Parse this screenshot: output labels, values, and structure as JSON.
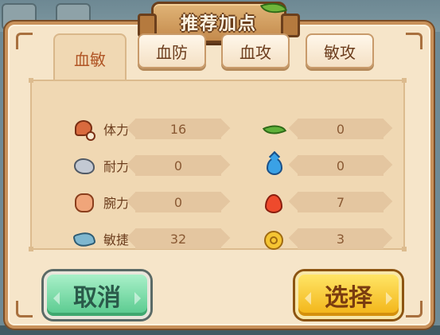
{
  "title": "推荐加点",
  "tabs": [
    {
      "label": "血敏",
      "active": true
    },
    {
      "label": "血防",
      "active": false
    },
    {
      "label": "血攻",
      "active": false
    },
    {
      "label": "敏攻",
      "active": false
    }
  ],
  "stats_left": [
    {
      "icon": "meat-icon",
      "label": "体力",
      "value": "16"
    },
    {
      "icon": "stone-icon",
      "label": "耐力",
      "value": "0"
    },
    {
      "icon": "fist-icon",
      "label": "腕力",
      "value": "0"
    },
    {
      "icon": "wing-icon",
      "label": "敏捷",
      "value": "32"
    }
  ],
  "stats_right": [
    {
      "icon": "leaf-icon",
      "value": "0"
    },
    {
      "icon": "water-drop-icon",
      "value": "0"
    },
    {
      "icon": "fire-icon",
      "value": "7"
    },
    {
      "icon": "wind-swirl-icon",
      "value": "3"
    }
  ],
  "buttons": {
    "cancel": "取消",
    "confirm": "选择"
  },
  "colors": {
    "parchment": "#f6e5c9",
    "wood_border": "#c8915a",
    "active_tab_text": "#b05525",
    "cancel_button": "#57c98d",
    "confirm_button": "#f2b316"
  }
}
